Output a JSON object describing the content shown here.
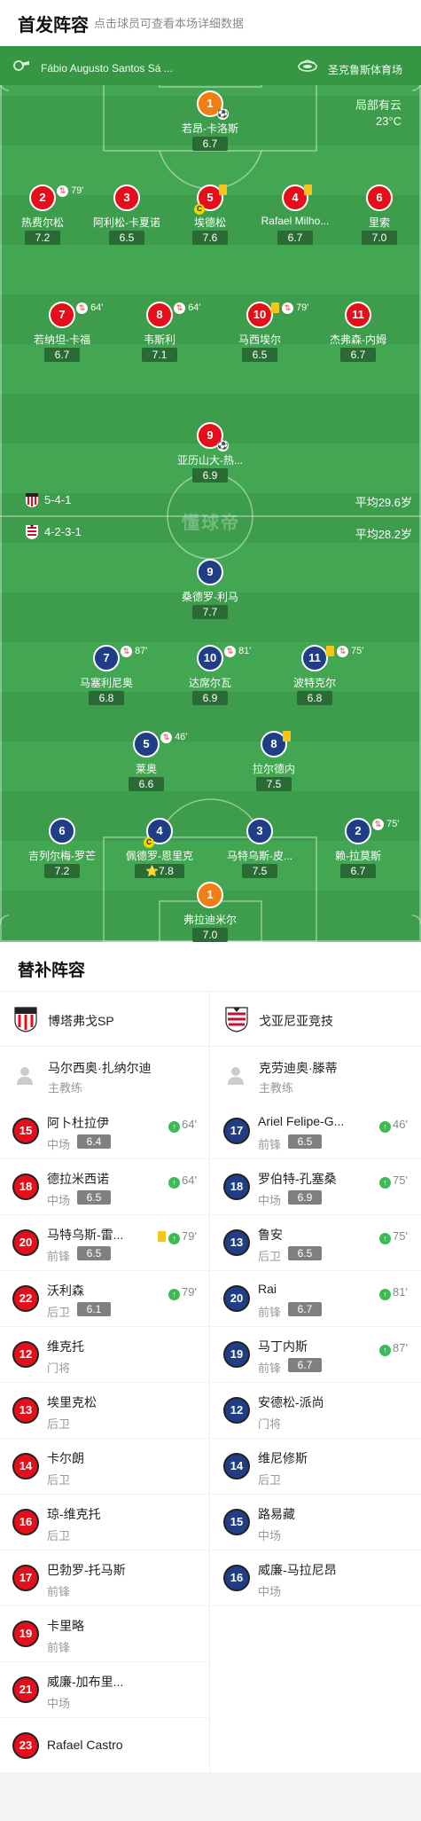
{
  "header": {
    "title": "首发阵容",
    "subtitle": "点击球员可查看本场详细数据"
  },
  "match_info": {
    "referee": "Fábio Augusto Santos Sá ...",
    "stadium": "圣克鲁斯体育场",
    "weather": "局部有云",
    "temperature": "23°C"
  },
  "watermark": "懂球帝",
  "home_team": {
    "name": "博塔弗戈SP",
    "formation": "5-4-1",
    "avg_age": "平均29.6岁",
    "color": "#e50f1b",
    "coach": {
      "name": "马尔西奥·扎纳尔迪",
      "role": "主教练"
    },
    "starters": [
      {
        "num": "1",
        "name": "若昂-卡洛斯",
        "rating": "6.7",
        "gk": true,
        "own_goal": true
      },
      {
        "num": "2",
        "name": "热费尔松",
        "rating": "7.2",
        "sub_out": "79'"
      },
      {
        "num": "3",
        "name": "阿利松-卡夏诺",
        "rating": "6.5"
      },
      {
        "num": "5",
        "name": "埃德松",
        "rating": "7.6",
        "yellow": true,
        "captain": true
      },
      {
        "num": "4",
        "name": "Rafael Milho...",
        "rating": "6.7",
        "yellow": true
      },
      {
        "num": "6",
        "name": "里索",
        "rating": "7.0"
      },
      {
        "num": "7",
        "name": "若纳坦-卡福",
        "rating": "6.7",
        "sub_out": "64'"
      },
      {
        "num": "8",
        "name": "韦斯利",
        "rating": "7.1",
        "sub_out": "64'"
      },
      {
        "num": "10",
        "name": "马西埃尔",
        "rating": "6.5",
        "yellow": true,
        "sub_out": "79'"
      },
      {
        "num": "11",
        "name": "杰弗森-内姆",
        "rating": "6.7"
      },
      {
        "num": "9",
        "name": "亚历山大-热...",
        "rating": "6.9",
        "goal": true
      }
    ],
    "subs": [
      {
        "num": "15",
        "name": "阿卜杜拉伊",
        "pos": "中场",
        "rating": "6.4",
        "in": "64'"
      },
      {
        "num": "18",
        "name": "德拉米西诺",
        "pos": "中场",
        "rating": "6.5",
        "in": "64'"
      },
      {
        "num": "20",
        "name": "马特乌斯-雷...",
        "pos": "前锋",
        "rating": "6.5",
        "in": "79'",
        "yellow": true
      },
      {
        "num": "22",
        "name": "沃利森",
        "pos": "后卫",
        "rating": "6.1",
        "in": "79'"
      },
      {
        "num": "12",
        "name": "维克托",
        "pos": "门将"
      },
      {
        "num": "13",
        "name": "埃里克松",
        "pos": "后卫"
      },
      {
        "num": "14",
        "name": "卡尔朗",
        "pos": "后卫"
      },
      {
        "num": "16",
        "name": "琼-维克托",
        "pos": "后卫"
      },
      {
        "num": "17",
        "name": "巴勃罗-托马斯",
        "pos": "前锋"
      },
      {
        "num": "19",
        "name": "卡里略",
        "pos": "前锋"
      },
      {
        "num": "21",
        "name": "威廉-加布里...",
        "pos": "中场"
      },
      {
        "num": "23",
        "name": "Rafael Castro",
        "pos": ""
      }
    ]
  },
  "away_team": {
    "name": "戈亚尼亚竞技",
    "formation": "4-2-3-1",
    "avg_age": "平均28.2岁",
    "color": "#1f3e86",
    "coach": {
      "name": "克劳迪奥·滕蒂",
      "role": "主教练"
    },
    "starters": [
      {
        "num": "9",
        "name": "桑德罗-利马",
        "rating": "7.7"
      },
      {
        "num": "7",
        "name": "马塞利尼奥",
        "rating": "6.8",
        "sub_out": "87'"
      },
      {
        "num": "10",
        "name": "达席尔瓦",
        "rating": "6.9",
        "sub_out": "81'"
      },
      {
        "num": "11",
        "name": "波特克尔",
        "rating": "6.8",
        "yellow": true,
        "sub_out": "75'"
      },
      {
        "num": "5",
        "name": "莱奥",
        "rating": "6.6",
        "sub_out": "46'"
      },
      {
        "num": "8",
        "name": "拉尔德内",
        "rating": "7.5",
        "yellow": true
      },
      {
        "num": "6",
        "name": "吉列尔梅-罗芒",
        "rating": "7.2"
      },
      {
        "num": "4",
        "name": "佩德罗-恩里克",
        "rating": "7.8",
        "captain": true,
        "star": true
      },
      {
        "num": "3",
        "name": "马特乌斯-皮...",
        "rating": "7.5"
      },
      {
        "num": "2",
        "name": "赖-拉莫斯",
        "rating": "6.7",
        "sub_out": "75'"
      },
      {
        "num": "1",
        "name": "弗拉迪米尔",
        "rating": "7.0",
        "gk": true
      }
    ],
    "subs": [
      {
        "num": "17",
        "name": "Ariel Felipe-G...",
        "pos": "前锋",
        "rating": "6.5",
        "in": "46'"
      },
      {
        "num": "18",
        "name": "罗伯特-孔塞桑",
        "pos": "中场",
        "rating": "6.9",
        "in": "75'"
      },
      {
        "num": "13",
        "name": "鲁安",
        "pos": "后卫",
        "rating": "6.5",
        "in": "75'"
      },
      {
        "num": "20",
        "name": "Rai",
        "pos": "前锋",
        "rating": "6.7",
        "in": "81'"
      },
      {
        "num": "19",
        "name": "马丁内斯",
        "pos": "前锋",
        "rating": "6.7",
        "in": "87'"
      },
      {
        "num": "12",
        "name": "安德松-派尚",
        "pos": "门将"
      },
      {
        "num": "14",
        "name": "维尼修斯",
        "pos": "后卫"
      },
      {
        "num": "15",
        "name": "路易藏",
        "pos": "中场"
      },
      {
        "num": "16",
        "name": "威廉-马拉尼昂",
        "pos": "中场"
      }
    ]
  },
  "subs_section": {
    "title": "替补阵容"
  },
  "icons": {
    "referee": "whistle-icon",
    "stadium": "stadium-icon",
    "substitution": "substitution-icon",
    "yellow_card": "yellow-card-icon",
    "captain": "captain-icon",
    "goal": "football-icon",
    "coach": "person-icon"
  }
}
